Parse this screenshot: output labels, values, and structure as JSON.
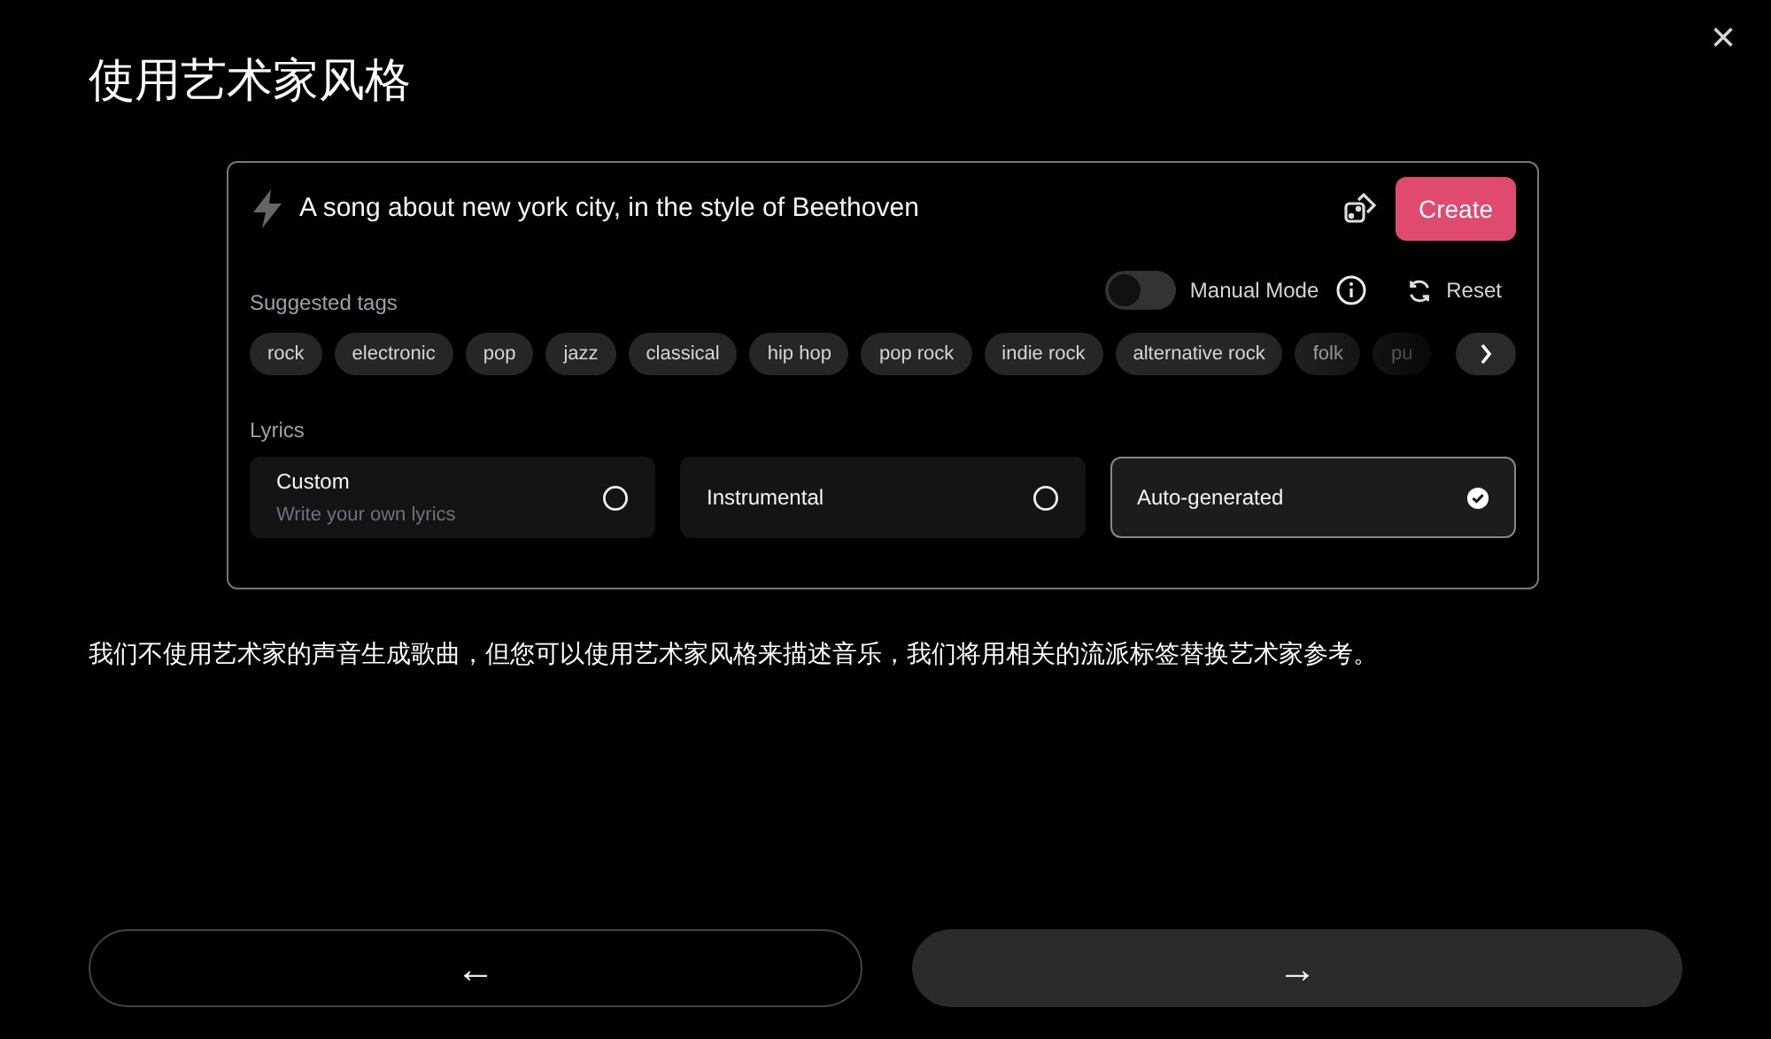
{
  "title": "使用艺术家风格",
  "close": "×",
  "prompt": {
    "text": "A song about new york city, in the style of Beethoven",
    "create_button": "Create"
  },
  "manual_mode": {
    "label": "Manual Mode",
    "on": false
  },
  "reset": "Reset",
  "suggested_tags": {
    "label": "Suggested tags",
    "tags": [
      "rock",
      "electronic",
      "pop",
      "jazz",
      "classical",
      "hip hop",
      "pop rock",
      "indie rock",
      "alternative rock",
      "folk",
      "pu"
    ]
  },
  "lyrics": {
    "label": "Lyrics",
    "options": [
      {
        "title": "Custom",
        "subtitle": "Write your own lyrics",
        "selected": false
      },
      {
        "title": "Instrumental",
        "selected": false
      },
      {
        "title": "Auto-generated",
        "selected": true
      }
    ]
  },
  "description": "我们不使用艺术家的声音生成歌曲，但您可以使用艺术家风格来描述音乐，我们将用相关的流派标签替换艺术家参考。",
  "buttons": [
    "←",
    "→"
  ]
}
